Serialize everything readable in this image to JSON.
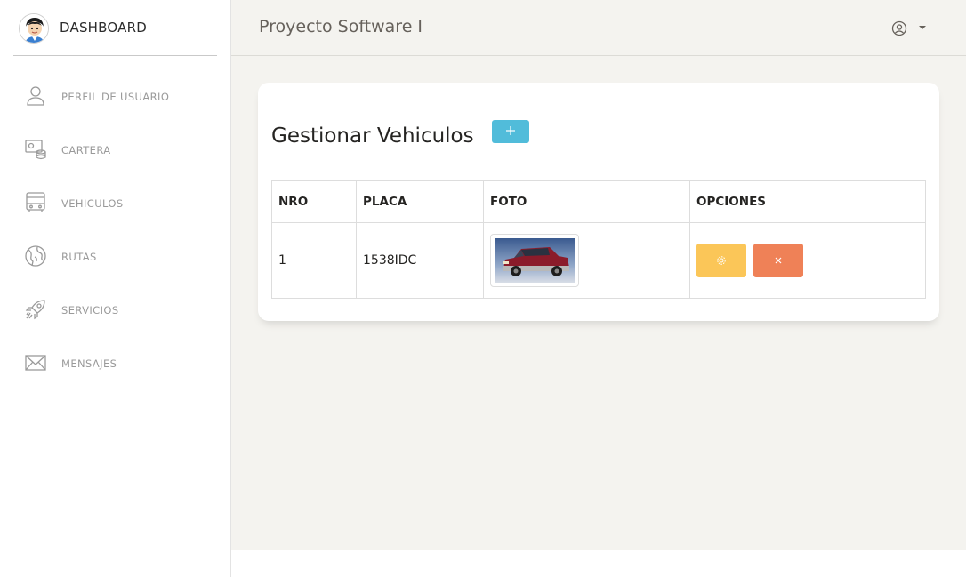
{
  "brand": {
    "name": "DASHBOARD",
    "logo_icon": "avatar-icon"
  },
  "sidebar": {
    "items": [
      {
        "label": "PERFIL DE USUARIO",
        "icon": "user-icon"
      },
      {
        "label": "CARTERA",
        "icon": "wallet-icon"
      },
      {
        "label": "VEHICULOS",
        "icon": "bus-icon"
      },
      {
        "label": "RUTAS",
        "icon": "globe-icon"
      },
      {
        "label": "SERVICIOS",
        "icon": "rocket-icon"
      },
      {
        "label": "MENSAJES",
        "icon": "mail-icon"
      }
    ]
  },
  "header": {
    "title": "Proyecto Software I",
    "user_icon": "user-circle-icon"
  },
  "main": {
    "title": "Gestionar Vehiculos",
    "add_button_icon": "plus-icon",
    "table": {
      "headers": [
        "NRO",
        "PLACA",
        "FOTO",
        "OPCIONES"
      ],
      "rows": [
        {
          "nro": "1",
          "placa": "1538IDC",
          "foto": "vehicle-photo"
        }
      ]
    },
    "actions": {
      "edit_icon": "gear-icon",
      "delete_icon": "close-icon"
    }
  },
  "colors": {
    "accent_info": "#51bcda",
    "warning": "#fbc658",
    "danger": "#ef8157",
    "background": "#f4f3ef"
  }
}
